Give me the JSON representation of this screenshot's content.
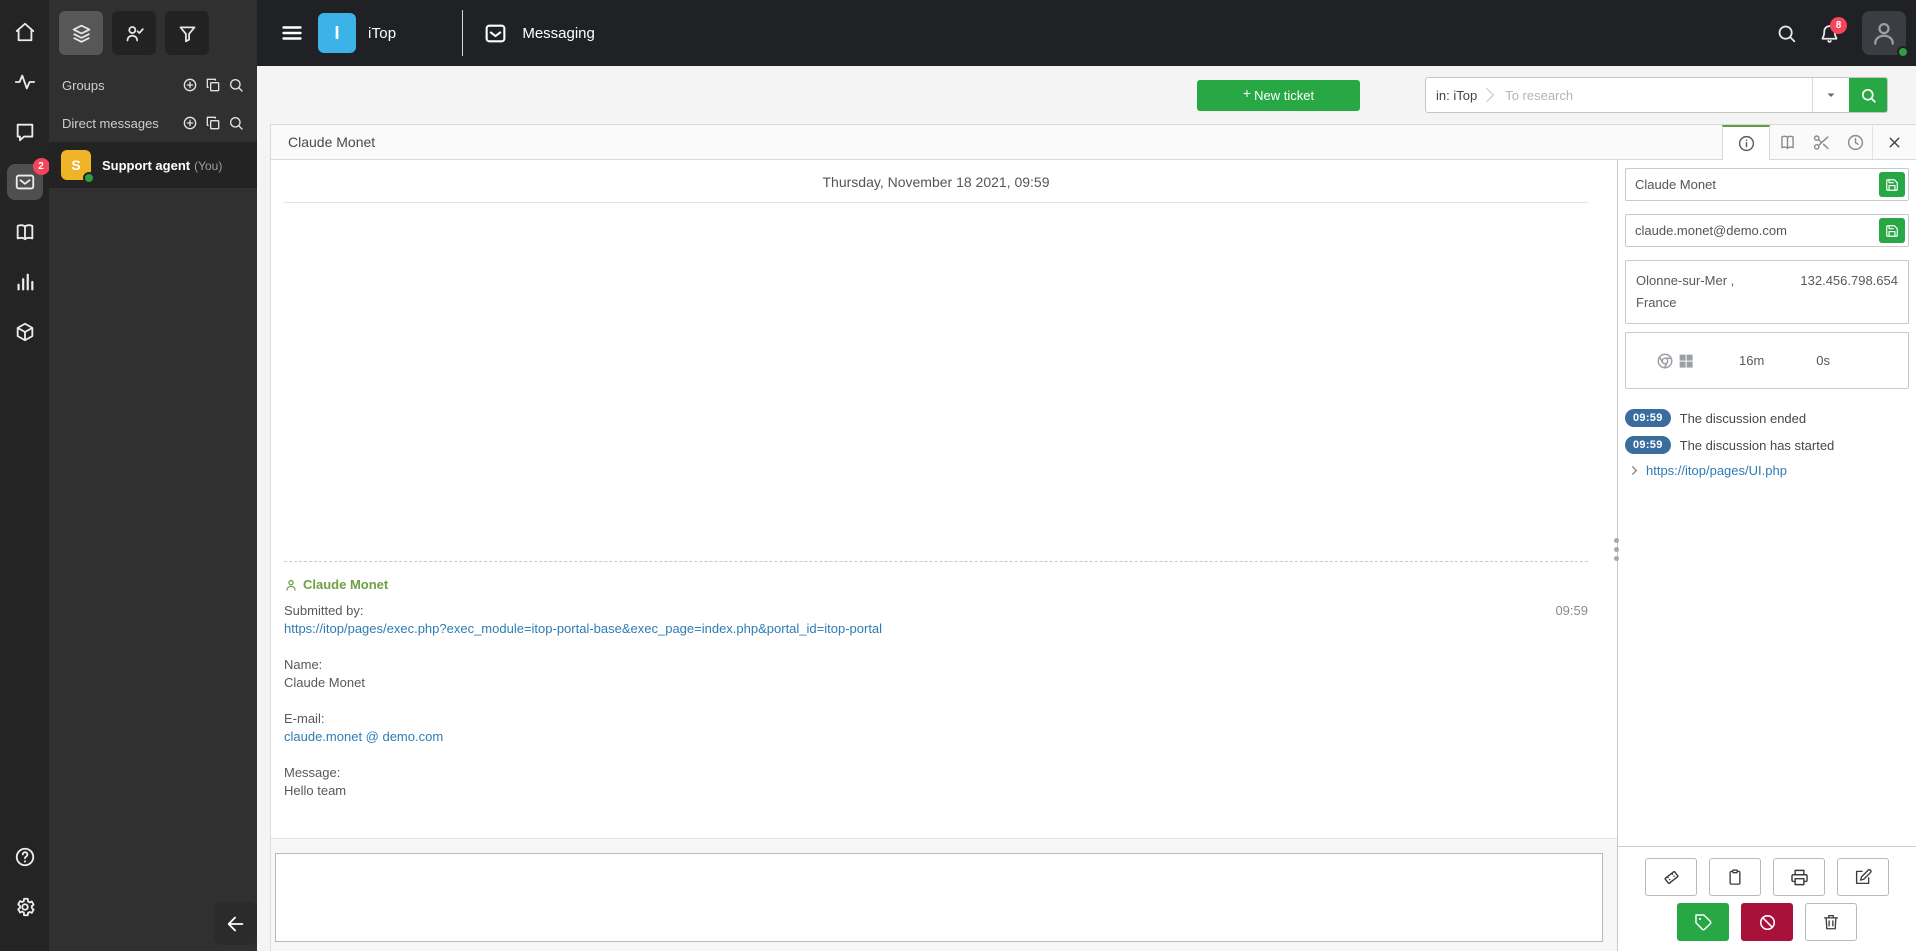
{
  "colors": {
    "accent_green": "#28a745",
    "danger_red": "#a8113a",
    "badge_red": "#f5455c",
    "time_badge_blue": "#3a6d9e",
    "link_blue": "#2d7cb5",
    "author_green": "#6ea044",
    "logo_blue": "#3cb3e8",
    "avatar_yellow": "#f0b429",
    "presence_green": "#2f9e44"
  },
  "icons": {
    "rail": [
      "home-icon",
      "activity-icon",
      "chat-bubble-icon",
      "omnichannel-inbox-icon",
      "book-icon",
      "bar-chart-icon",
      "cube-icon",
      "help-icon",
      "gear-icon"
    ],
    "sidebar": [
      "layers-icon",
      "person-check-icon",
      "filter-icon",
      "plus-circle-icon",
      "copy-icon",
      "search-icon"
    ],
    "topbar": [
      "hamburger-icon",
      "messaging-tray-icon",
      "search-icon",
      "bell-icon",
      "person-icon"
    ],
    "tabs": [
      "info-icon",
      "book-icon",
      "scissors-icon",
      "clock-icon",
      "close-icon"
    ],
    "panel": [
      "save-icon",
      "chrome-icon",
      "windows-icon",
      "chevron-right-icon"
    ],
    "actions": [
      "ticket-icon",
      "clipboard-icon",
      "printer-icon",
      "edit-icon",
      "tag-icon",
      "ban-icon",
      "trash-icon"
    ],
    "misc": [
      "caret-down-icon",
      "arrow-left-icon",
      "plus-icon"
    ]
  },
  "rail": {
    "inbox_badge": "2"
  },
  "sidebar": {
    "groups_label": "Groups",
    "dm_label": "Direct messages",
    "agent": {
      "initial": "S",
      "name": "Support agent",
      "suffix": "(You)"
    }
  },
  "topbar": {
    "app_initial": "I",
    "app_name": "iTop",
    "section": "Messaging",
    "bell_badge": "8"
  },
  "toolbar": {
    "new_ticket_plus": "+",
    "new_ticket_label": "New ticket",
    "search_tag": "in: iTop",
    "search_placeholder": "To research"
  },
  "chat": {
    "title": "Claude Monet",
    "date_header": "Thursday, November 18 2021, 09:59",
    "message": {
      "author": "Claude Monet",
      "time": "09:59",
      "submitted_by_label": "Submitted by:",
      "submitted_by_url": "https://itop/pages/exec.php?exec_module=itop-portal-base&exec_page=index.php&portal_id=itop-portal",
      "name_label": "Name:",
      "name_value": "Claude Monet",
      "email_label": "E-mail:",
      "email_value": "claude.monet @ demo.com",
      "message_label": "Message:",
      "message_value": "Hello team"
    }
  },
  "panel": {
    "name_value": "Claude Monet",
    "email_value": "claude.monet@demo.com",
    "location_line1": "Olonne-sur-Mer ,",
    "location_line2": "France",
    "ip": "132.456.798.654",
    "session_duration": "16m",
    "idle_time": "0s",
    "events": [
      {
        "time": "09:59",
        "text": "The discussion ended"
      },
      {
        "time": "09:59",
        "text": "The discussion has started"
      }
    ],
    "referrer_link": "https://itop/pages/UI.php"
  }
}
